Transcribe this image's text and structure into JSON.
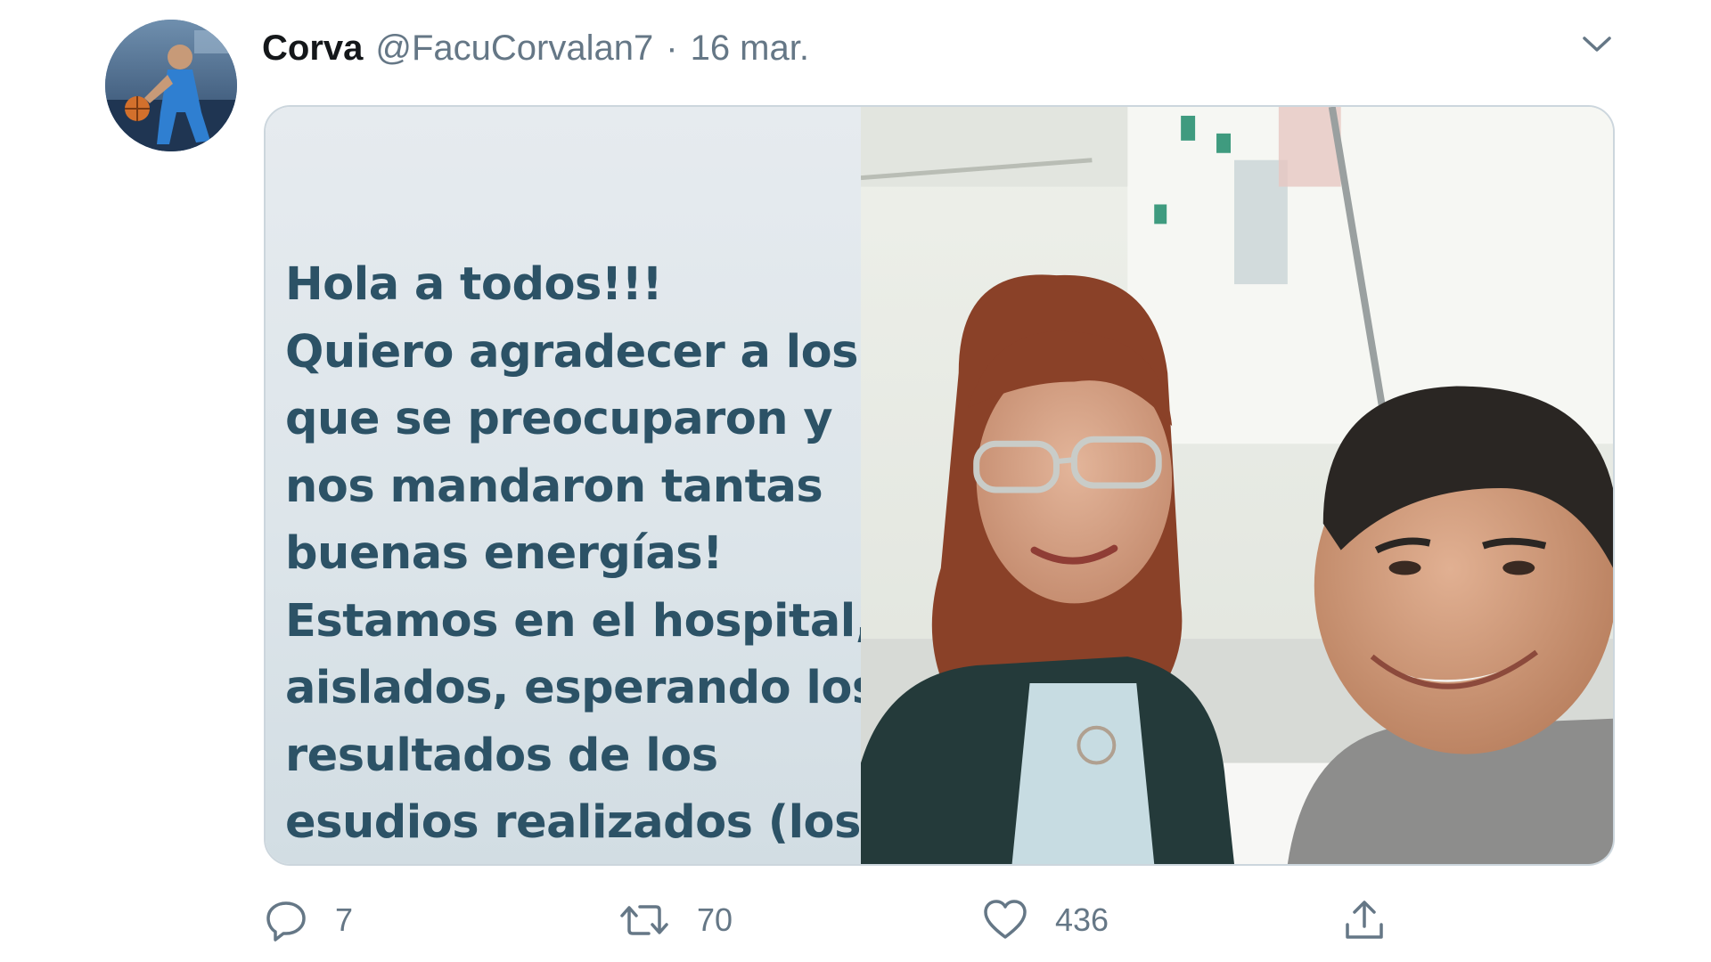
{
  "tweet": {
    "author_name": "Corva",
    "author_handle": "@FacuCorvalan7",
    "separator": "·",
    "date": "16 mar.",
    "menu_icon": "chevron-down-icon",
    "avatar_icon": "basketball-player-avatar",
    "media": {
      "text_lines": [
        "Hola a todos!!!",
        "Quiero agradecer a los",
        "que se preocuparon y",
        "nos mandaron tantas",
        "buenas energías!",
        "Estamos en el hospital,",
        "aislados, esperando los",
        "resultados de los",
        "esudios realizados (los"
      ],
      "photo": "selfie-in-hospital-room"
    },
    "actions": {
      "reply": {
        "icon": "reply-icon",
        "count": "7"
      },
      "retweet": {
        "icon": "retweet-icon",
        "count": "70"
      },
      "like": {
        "icon": "heart-icon",
        "count": "436"
      },
      "share": {
        "icon": "share-icon"
      }
    },
    "colors": {
      "text_primary": "#14171a",
      "text_secondary": "#657786",
      "border": "#ccd6dd",
      "story_text": "#2c5266"
    }
  }
}
